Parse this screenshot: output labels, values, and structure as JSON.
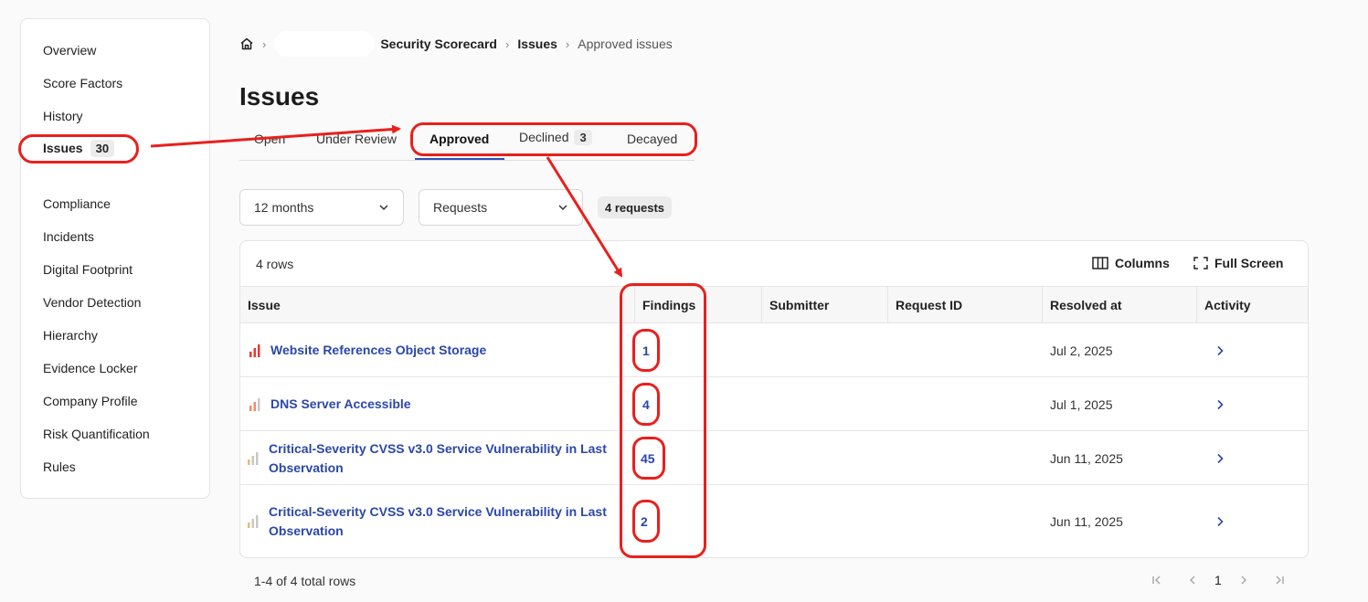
{
  "sidebar": {
    "items": [
      {
        "label": "Overview"
      },
      {
        "label": "Score Factors"
      },
      {
        "label": "History"
      },
      {
        "label": "Issues",
        "badge": "30"
      },
      {
        "label": "Compliance"
      },
      {
        "label": "Incidents"
      },
      {
        "label": "Digital Footprint"
      },
      {
        "label": "Vendor Detection"
      },
      {
        "label": "Hierarchy"
      },
      {
        "label": "Evidence Locker"
      },
      {
        "label": "Company Profile"
      },
      {
        "label": "Risk Quantification"
      },
      {
        "label": "Rules"
      }
    ]
  },
  "breadcrumb": {
    "home_icon": "home-icon",
    "section": "Security Scorecard",
    "parent": "Issues",
    "current": "Approved issues"
  },
  "page": {
    "title": "Issues"
  },
  "tabs": [
    {
      "label": "Open"
    },
    {
      "label": "Under Review"
    },
    {
      "label": "Approved"
    },
    {
      "label": "Declined",
      "badge": "3"
    },
    {
      "label": "Decayed"
    }
  ],
  "filters": {
    "period": "12 months",
    "type": "Requests",
    "count_pill": "4 requests"
  },
  "table": {
    "rows_label": "4 rows",
    "columns_button": "Columns",
    "fullscreen_button": "Full Screen",
    "headers": [
      "Issue",
      "Findings",
      "Submitter",
      "Request ID",
      "Resolved at",
      "Activity"
    ],
    "rows": [
      {
        "issue": "Website References Object Storage",
        "findings": "1",
        "resolved": "Jul 2, 2025",
        "severity": "high"
      },
      {
        "issue": "DNS Server Accessible",
        "findings": "4",
        "resolved": "Jul 1, 2025",
        "severity": "medium"
      },
      {
        "issue": "Critical-Severity CVSS v3.0 Service Vulnerability in Last Observation",
        "findings": "45",
        "resolved": "Jun 11, 2025",
        "severity": "low"
      },
      {
        "issue": "Critical-Severity CVSS v3.0 Service Vulnerability in Last Observation",
        "findings": "2",
        "resolved": "Jun 11, 2025",
        "severity": "low"
      }
    ],
    "footer_count": "1-4 of 4 total rows",
    "current_page": "1"
  },
  "colors": {
    "link": "#2b47a8",
    "annotation": "#e8201c",
    "severity_high": "#e53935",
    "severity_medium": "#f28a6b",
    "severity_low": "#e8b879",
    "severity_inactive": "#c8c8c8"
  }
}
